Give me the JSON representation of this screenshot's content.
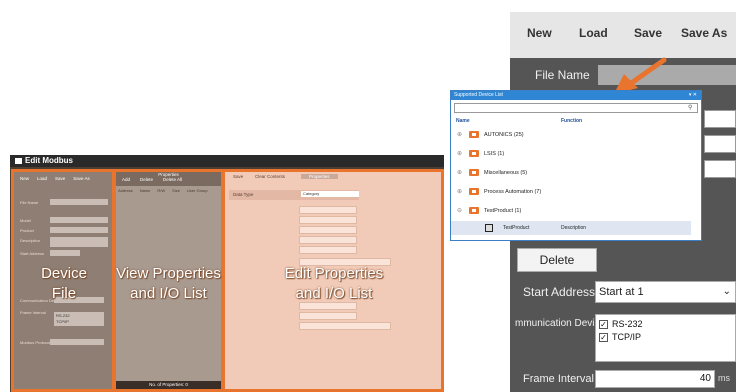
{
  "small_window": {
    "title": "Edit Modbus",
    "toolbar": [
      "New",
      "Load",
      "Save",
      "Save As"
    ],
    "left_panel_overlay": [
      "Device",
      "File"
    ],
    "middle_panel_overlay": [
      "View Properties",
      "and I/O List"
    ],
    "right_panel_overlay": [
      "Edit Properties",
      "and I/O List"
    ],
    "middle_header": [
      "Properties",
      "Add",
      "Delete",
      "Delete All"
    ],
    "middle_columns": [
      "Address",
      "Name",
      "R/W",
      "Size",
      "User Group"
    ],
    "middle_footer": "No. of Properties: 0",
    "right_tabs": [
      "Save",
      "Clear Contents",
      "Properties"
    ],
    "right_select_label": "Data Type",
    "right_select_value": "Category",
    "left_labels": [
      "File Name",
      "Model",
      "Product",
      "Description",
      "Start Address",
      "Communication Device",
      "Frame Interval",
      "Modbus Protocol"
    ],
    "left_values": [
      "RS-232",
      "TCP/IP"
    ]
  },
  "app": {
    "toolbar": {
      "new": "New",
      "load": "Load",
      "save": "Save",
      "save_as": "Save As"
    },
    "file_name_label": "File Name",
    "delete_label": "Delete",
    "start_address_label": "Start Address",
    "start_address_value": "Start at 1",
    "comm_device_label": "mmunication Devi",
    "comm_options": [
      {
        "label": "RS-232",
        "checked": true
      },
      {
        "label": "TCP/IP",
        "checked": true
      }
    ],
    "frame_interval_label": "Frame Interval",
    "frame_interval_value": "40",
    "frame_interval_unit": "ms"
  },
  "popup": {
    "title": "Supported Device List",
    "controls": "▾ ✕",
    "search_placeholder": "",
    "col_name": "Name",
    "col_function": "Function",
    "groups": [
      "AUTONICS (25)",
      "LSIS (1)",
      "Miscellaneous (5)",
      "Process Automation (7)",
      "TestProduct (1)"
    ],
    "child": {
      "name": "TestProduct",
      "function": "Description"
    }
  },
  "colors": {
    "accent_orange": "#e8742e",
    "popup_title": "#2e86d4",
    "app_bg": "#555555"
  }
}
